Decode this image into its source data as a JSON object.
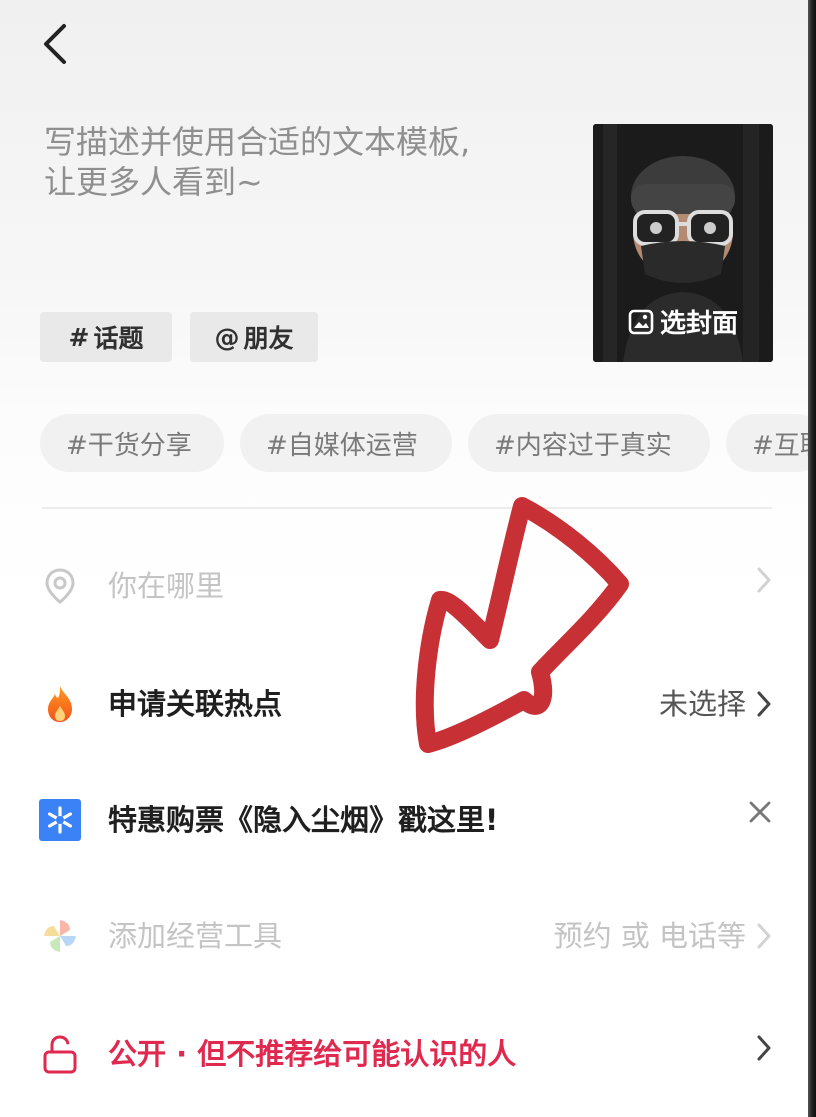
{
  "header": {
    "back_icon": "chevron-left-icon"
  },
  "description": {
    "placeholder_line1": "写描述并使用合适的文本模板,",
    "placeholder_line2": "让更多人看到~"
  },
  "tag_buttons": [
    {
      "icon": "#",
      "label": "话题"
    },
    {
      "icon": "@",
      "label": "朋友"
    }
  ],
  "cover": {
    "label": "选封面",
    "icon": "image-icon"
  },
  "hashtag_chips": [
    "#干货分享",
    "#自媒体运营",
    "#内容过于真实",
    "#互联"
  ],
  "rows": {
    "location": {
      "label": "你在哪里",
      "icon": "location-pin-icon"
    },
    "hotspot": {
      "label": "申请关联热点",
      "value": "未选择",
      "icon": "flame-icon"
    },
    "promo": {
      "label": "特惠购票《隐入尘烟》戳这里!",
      "icon": "ticket-star-icon",
      "close": "×"
    },
    "tools": {
      "label": "添加经营工具",
      "value": "预约 或 电话等",
      "icon": "pinwheel-icon"
    },
    "privacy": {
      "label": "公开 · 但不推荐给可能认识的人",
      "icon": "unlock-icon"
    }
  },
  "colors": {
    "accent_red": "#e0294f",
    "promo_blue": "#3b82f6",
    "overlay_arrow": "#c4262b"
  }
}
